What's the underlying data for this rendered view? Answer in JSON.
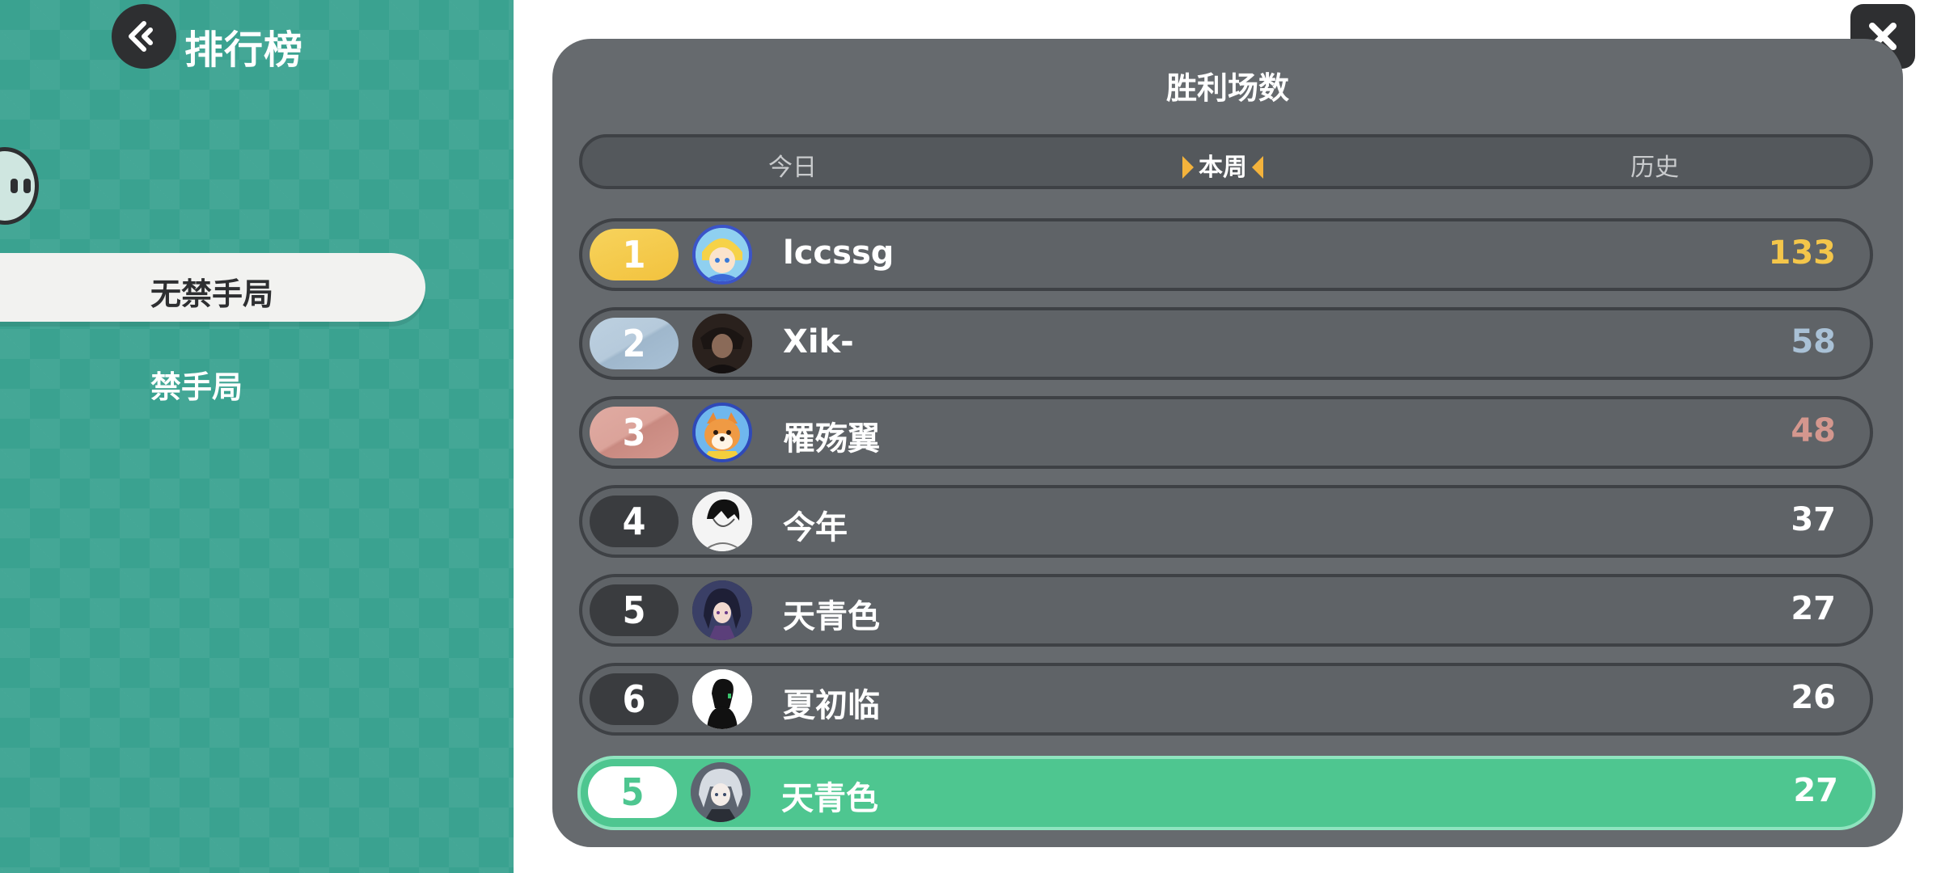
{
  "header": {
    "title": "排行榜"
  },
  "sidebar": {
    "modes": [
      {
        "label": "无禁手局",
        "active": true
      },
      {
        "label": "禁手局",
        "active": false
      }
    ]
  },
  "panel": {
    "title": "胜利场数",
    "periods": [
      {
        "label": "今日",
        "active": false
      },
      {
        "label": "本周",
        "active": true
      },
      {
        "label": "历史",
        "active": false
      }
    ]
  },
  "leaderboard": {
    "rows": [
      {
        "rank": "1",
        "name": "lccssg",
        "score": "133"
      },
      {
        "rank": "2",
        "name": "Xik-",
        "score": "58"
      },
      {
        "rank": "3",
        "name": "罹殇翼",
        "score": "48"
      },
      {
        "rank": "4",
        "name": "今年",
        "score": "37"
      },
      {
        "rank": "5",
        "name": "天青色",
        "score": "27"
      },
      {
        "rank": "6",
        "name": "夏初临",
        "score": "26"
      }
    ],
    "self": {
      "rank": "5",
      "name": "天青色",
      "score": "27"
    }
  },
  "colors": {
    "sidebar_bg": "#3aa290",
    "panel_bg": "#666a6e",
    "gold": "#f4c64a",
    "silver": "#a9c1d6",
    "bronze": "#d4978e",
    "self_row": "#4ec690",
    "active_marker": "#f4b33c"
  },
  "icons": {
    "back": "back-arrow-icon",
    "close": "close-icon"
  }
}
